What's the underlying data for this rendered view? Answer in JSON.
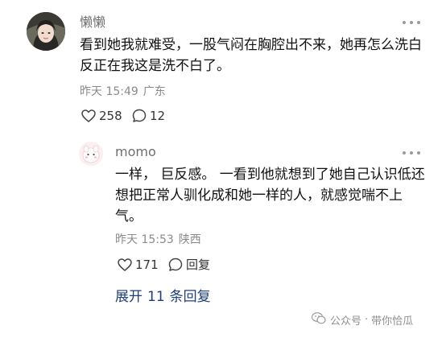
{
  "comment": {
    "username": "懒懒",
    "text": "看到她我就难受，一股气闷在胸腔出不来，她再怎么洗白反正在我这是洗不白了。",
    "time": "昨天 15:49",
    "location": "广东",
    "likes": "258",
    "replies": "12"
  },
  "reply": {
    "username": "momo",
    "text": "一样， 巨反感。 一看到他就想到了她自己认识低还想把正常人驯化成和她一样的人，就感觉喘不上气。",
    "time": "昨天 15:53",
    "location": "陕西",
    "likes": "171",
    "reply_label": "回复"
  },
  "expand": {
    "prefix": "展开",
    "count": "11",
    "suffix": "条回复"
  },
  "watermark": {
    "label1": "公众号",
    "label2": "带你恰瓜"
  },
  "icons": {
    "like": "heart-outline-icon",
    "comment": "speech-bubble-icon",
    "more": "more-dots-icon",
    "watermark": "wechat-logo-icon"
  },
  "colors": {
    "text": "#111111",
    "meta": "#8a8a8a",
    "link": "#1f3f77"
  }
}
